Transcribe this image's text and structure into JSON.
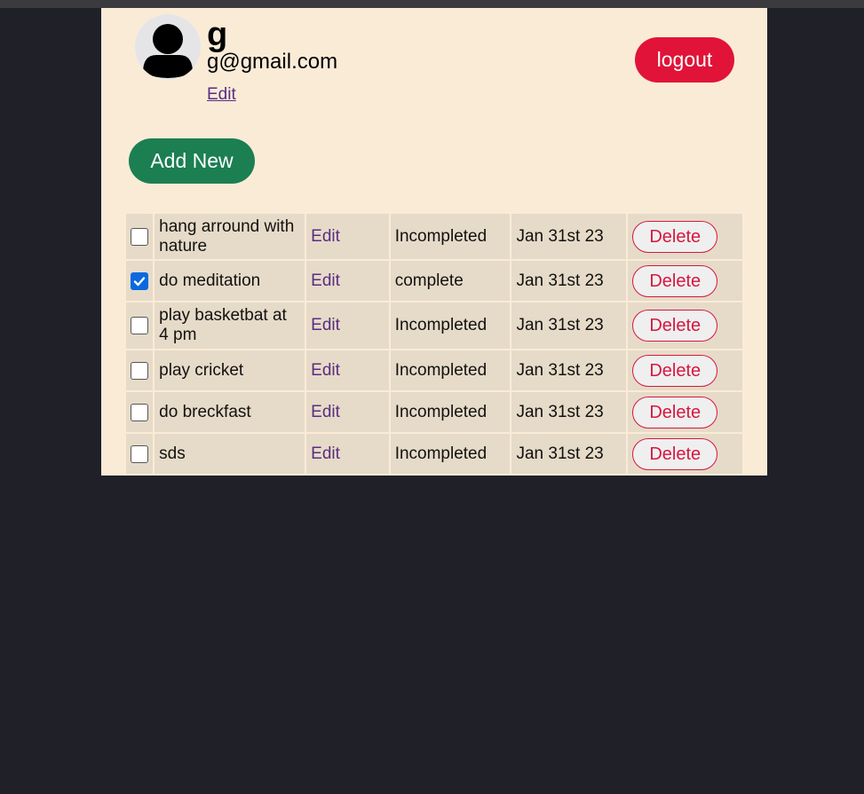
{
  "colors": {
    "background": "#202029",
    "panel": "#faebd7",
    "logout": "#e11338",
    "add_new": "#1b7f52",
    "link": "#5b2c83",
    "checkbox_checked": "#0a69e0"
  },
  "profile": {
    "name": "g",
    "email": "g@gmail.com",
    "edit_label": "Edit",
    "avatar_icon": "user-icon"
  },
  "header": {
    "logout_label": "logout"
  },
  "actions": {
    "add_new_label": "Add New"
  },
  "todos": [
    {
      "title": "hang arround with nature",
      "edit_label": "Edit",
      "status": "Incompleted",
      "date": "Jan 31st 23",
      "delete_label": "Delete",
      "checked": false
    },
    {
      "title": "do meditation",
      "edit_label": "Edit",
      "status": "complete",
      "date": "Jan 31st 23",
      "delete_label": "Delete",
      "checked": true
    },
    {
      "title": "play basketbat at 4 pm",
      "edit_label": "Edit",
      "status": "Incompleted",
      "date": "Jan 31st 23",
      "delete_label": "Delete",
      "checked": false
    },
    {
      "title": "play cricket",
      "edit_label": "Edit",
      "status": "Incompleted",
      "date": "Jan 31st 23",
      "delete_label": "Delete",
      "checked": false
    },
    {
      "title": "do breckfast",
      "edit_label": "Edit",
      "status": "Incompleted",
      "date": "Jan 31st 23",
      "delete_label": "Delete",
      "checked": false
    },
    {
      "title": "sds",
      "edit_label": "Edit",
      "status": "Incompleted",
      "date": "Jan 31st 23",
      "delete_label": "Delete",
      "checked": false
    }
  ]
}
